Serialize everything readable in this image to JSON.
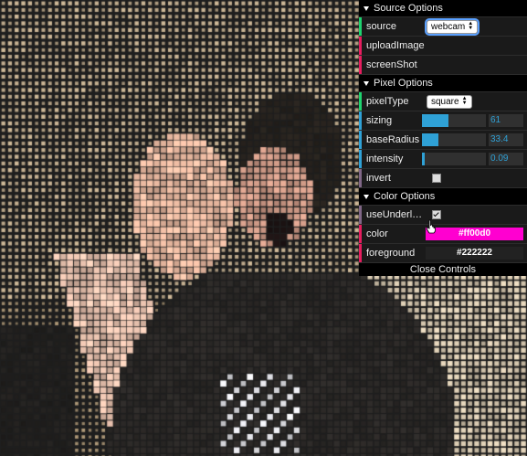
{
  "source_options": {
    "title": "Source Options",
    "source_label": "source",
    "source_value": "webcam",
    "upload_label": "uploadImage",
    "screenshot_label": "screenShot"
  },
  "pixel_options": {
    "title": "Pixel Options",
    "pixel_type_label": "pixelType",
    "pixel_type_value": "square",
    "sizing_label": "sizing",
    "sizing_value": "61",
    "sizing_fraction": 0.42,
    "base_radius_label": "baseRadius",
    "base_radius_value": "33.4",
    "base_radius_fraction": 0.25,
    "intensity_label": "intensity",
    "intensity_value": "0.09",
    "intensity_fraction": 0.04,
    "invert_label": "invert",
    "invert_checked": false
  },
  "color_options": {
    "title": "Color Options",
    "use_underlying_label": "useUnderlyin...",
    "use_underlying_checked": true,
    "color_label": "color",
    "color_value": "#ff00d0",
    "foreground_label": "foreground",
    "foreground_value": "#222222"
  },
  "close_label": "Close Controls",
  "colors": {
    "accent_green": "#1ed36f",
    "accent_pink": "#e61d5f",
    "accent_blue": "#2fa1d6",
    "accent_gray": "#806787"
  }
}
